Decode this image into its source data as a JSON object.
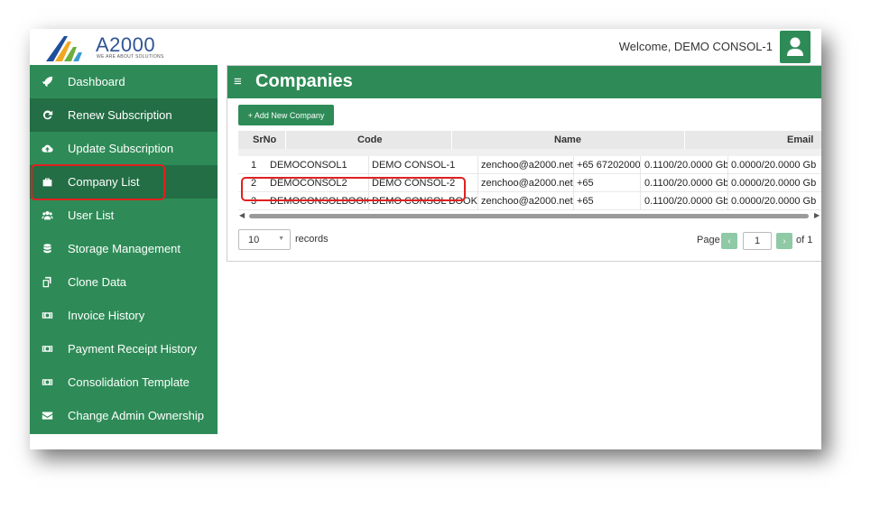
{
  "header": {
    "logo_text": "A2000",
    "logo_tagline": "WE ARE ABOUT SOLUTIONS",
    "welcome": "Welcome, DEMO CONSOL-1",
    "avatar_icon": "user-icon"
  },
  "sidebar": {
    "items": [
      {
        "label": "Dashboard",
        "icon": "rocket-icon"
      },
      {
        "label": "Renew Subscription",
        "icon": "refresh-icon"
      },
      {
        "label": "Update Subscription",
        "icon": "cloud-upload-icon"
      },
      {
        "label": "Company List",
        "icon": "briefcase-icon"
      },
      {
        "label": "User List",
        "icon": "users-icon"
      },
      {
        "label": "Storage Management",
        "icon": "database-icon"
      },
      {
        "label": "Clone Data",
        "icon": "copy-icon"
      },
      {
        "label": "Invoice History",
        "icon": "money-icon"
      },
      {
        "label": "Payment Receipt History",
        "icon": "money-icon"
      },
      {
        "label": "Consolidation Template",
        "icon": "money-icon"
      },
      {
        "label": "Change Admin Ownership",
        "icon": "envelope-icon"
      }
    ]
  },
  "main": {
    "menu_icon": "≡",
    "title": "Companies",
    "add_button": "+ Add New Company",
    "table": {
      "headers": [
        "SrNo",
        "Code",
        "Name",
        "Email"
      ],
      "rows": [
        [
          "1",
          "DEMOCONSOL1",
          "DEMO CONSOL-1",
          "zenchoo@a2000.net",
          "+65 67202000",
          "0.1100/20.0000 Gb",
          "0.0000/20.0000 Gb"
        ],
        [
          "2",
          "DEMOCONSOL2",
          "DEMO CONSOL-2",
          "zenchoo@a2000.net",
          "+65",
          "0.1100/20.0000 Gb",
          "0.0000/20.0000 Gb"
        ],
        [
          "3",
          "DEMOCONSOLBOOK",
          "DEMO CONSOL BOOK",
          "zenchoo@a2000.net",
          "+65",
          "0.1100/20.0000 Gb",
          "0.0000/20.0000 Gb"
        ]
      ]
    },
    "page_size": "10",
    "records_label": "records",
    "pager": {
      "page_label": "Page",
      "prev": "‹",
      "current": "1",
      "next": "›",
      "of_label": "of 1"
    }
  },
  "colors": {
    "brand_green": "#2e8b57",
    "highlight_red": "#e02020"
  }
}
